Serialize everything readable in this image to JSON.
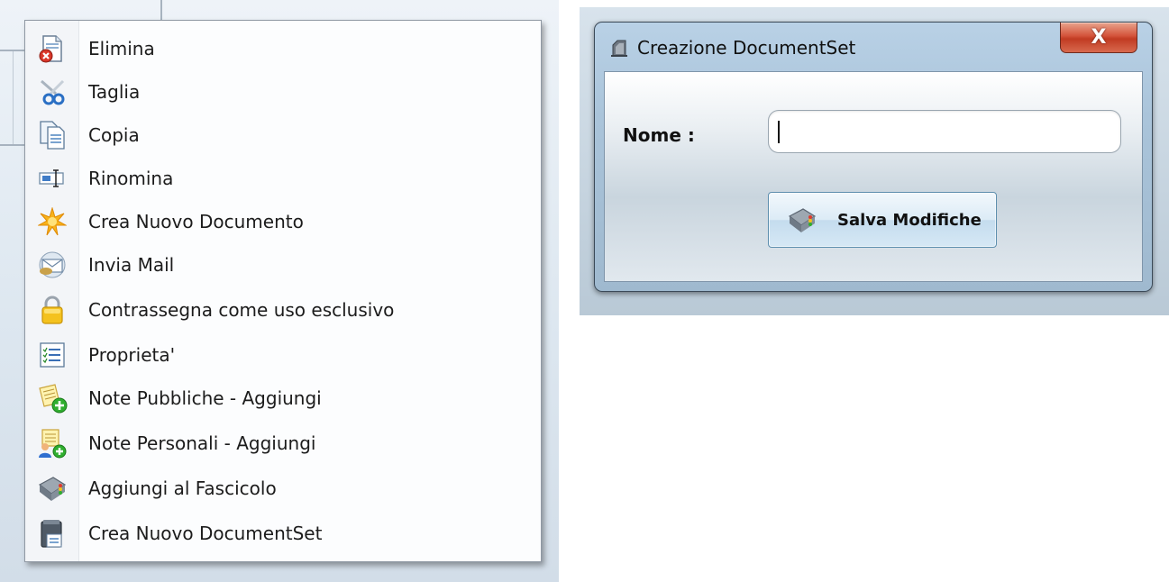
{
  "context_menu": {
    "items": [
      {
        "label": "Elimina",
        "icon": "delete-document-icon"
      },
      {
        "label": "Taglia",
        "icon": "scissors-icon"
      },
      {
        "label": "Copia",
        "icon": "copy-icon"
      },
      {
        "label": "Rinomina",
        "icon": "rename-icon"
      },
      {
        "label": "Crea Nuovo Documento",
        "icon": "new-document-star-icon"
      },
      {
        "label": "Invia Mail",
        "icon": "mail-icon"
      },
      {
        "label": "Contrassegna come uso esclusivo",
        "icon": "lock-icon"
      },
      {
        "label": "Proprieta'",
        "icon": "properties-icon"
      },
      {
        "label": "Note Pubbliche - Aggiungi",
        "icon": "public-note-add-icon"
      },
      {
        "label": "Note Personali - Aggiungi",
        "icon": "personal-note-add-icon"
      },
      {
        "label": "Aggiungi al Fascicolo",
        "icon": "dossier-icon"
      },
      {
        "label": "Crea Nuovo DocumentSet",
        "icon": "documentset-icon"
      }
    ]
  },
  "dialog": {
    "title": "Creazione DocumentSet",
    "close_label": "X",
    "nome_label": "Nome :",
    "nome_value": "",
    "save_label": "Salva Modifiche"
  },
  "colors": {
    "close_red": "#c13b22",
    "window_frame": "#aac4da",
    "menu_background": "#fcfdfe"
  }
}
